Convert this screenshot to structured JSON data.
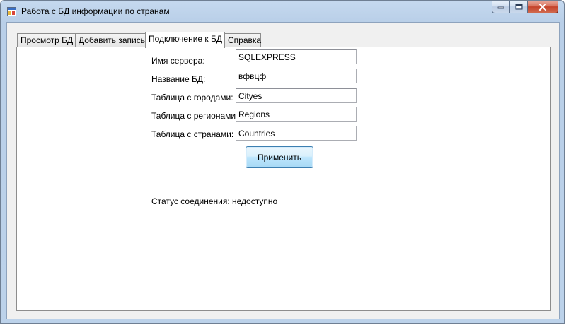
{
  "window": {
    "title": "Работа с БД информации по странам"
  },
  "tabs": [
    {
      "label": "Просмотр БД"
    },
    {
      "label": "Добавить запись"
    },
    {
      "label": "Подключение к БД"
    },
    {
      "label": "Справка"
    }
  ],
  "active_tab": "Подключение к БД",
  "form": {
    "server": {
      "label": "Имя сервера:",
      "value": "SQLEXPRESS"
    },
    "database": {
      "label": "Название БД:",
      "value": "вфвцф"
    },
    "cities_table": {
      "label": "Таблица  с городами:",
      "value": "Cityes"
    },
    "regions_table": {
      "label": "Таблица с регионами:",
      "value": "Regions"
    },
    "countries_table": {
      "label": "Таблица с странами:",
      "value": "Countries"
    },
    "apply_label": "Применить"
  },
  "status": {
    "text": "Статус соединения: недоступно"
  },
  "icons": {
    "app": "app-window-icon",
    "minimize": "minimize-icon",
    "maximize": "maximize-icon",
    "close": "close-icon"
  }
}
